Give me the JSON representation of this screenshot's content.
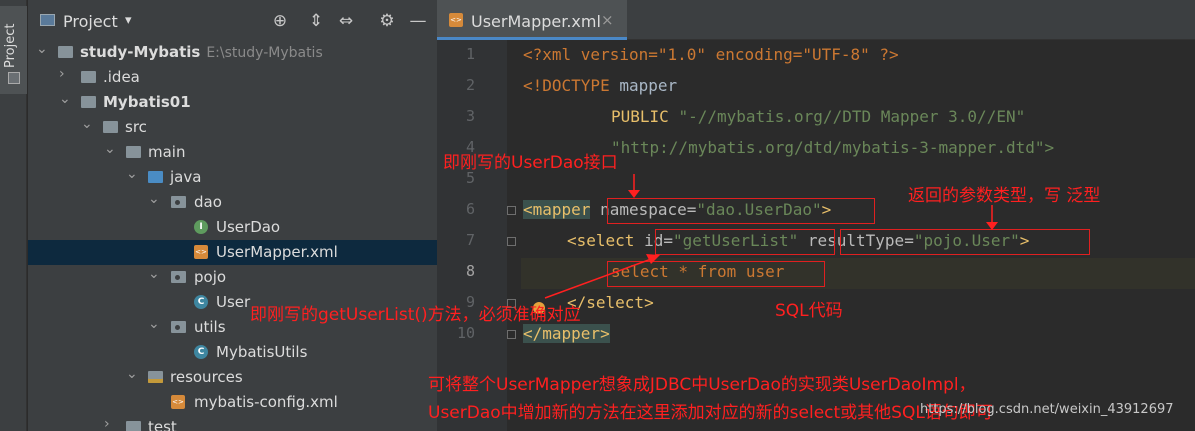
{
  "tool_stripe": {
    "label": "Project"
  },
  "project_panel": {
    "title": "Project",
    "tree": [
      {
        "label": "study-Mybatis",
        "path": "E:\\study-Mybatis"
      },
      {
        "label": ".idea"
      },
      {
        "label": "Mybatis01"
      },
      {
        "label": "src"
      },
      {
        "label": "main"
      },
      {
        "label": "java"
      },
      {
        "label": "dao"
      },
      {
        "label": "UserDao"
      },
      {
        "label": "UserMapper.xml"
      },
      {
        "label": "pojo"
      },
      {
        "label": "User"
      },
      {
        "label": "utils"
      },
      {
        "label": "MybatisUtils"
      },
      {
        "label": "resources"
      },
      {
        "label": "mybatis-config.xml"
      },
      {
        "label": "test"
      }
    ]
  },
  "editor": {
    "tab_label": "UserMapper.xml",
    "line_numbers": [
      "1",
      "2",
      "3",
      "4",
      "5",
      "6",
      "7",
      "8",
      "9",
      "10"
    ],
    "code": {
      "l1_decl": "<?xml version=\"1.0\" encoding=\"UTF-8\" ?>",
      "l2_doctype_kw": "<!DOCTYPE",
      "l2_doctype_name": " mapper",
      "l3_public": "PUBLIC ",
      "l3_str": "\"-//mybatis.org//DTD Mapper 3.0//EN\"",
      "l4_str": "\"http://mybatis.org/dtd/mybatis-3-mapper.dtd\">",
      "l6_open": "<mapper",
      "l6_attr": "namespace",
      "l6_eq": "=",
      "l6_val": "\"dao.UserDao\"",
      "l6_close": ">",
      "l7_open": "<select",
      "l7_attr1": "id",
      "l7_eq1": "=",
      "l7_val1": "\"getUserList\"",
      "l7_attr2": "resultType",
      "l7_eq2": "=",
      "l7_val2": "\"pojo.User\"",
      "l7_close": ">",
      "l8_sql": "select * from user",
      "l9_close": "</select>",
      "l10_close": "</mapper>"
    }
  },
  "annotations": {
    "interface_note": "即刚写的UserDao接口",
    "return_type_note": "返回的参数类型，写 泛型",
    "method_note": "即刚写的getUserList()方法，必须准确对应",
    "sql_note": "SQL代码",
    "summary_line1": "可将整个UserMapper想象成JDBC中UserDao的实现类UserDaoImpl，",
    "summary_line2": "UserDao中增加新的方法在这里添加对应的新的select或其他SQL语句即可"
  },
  "watermark": "https://blog.csdn.net/weixin_43912697",
  "colors": {
    "annotation_red": "#ff2020",
    "tag": "#e8bf6a",
    "string": "#6a8759",
    "keyword": "#cc7832"
  }
}
